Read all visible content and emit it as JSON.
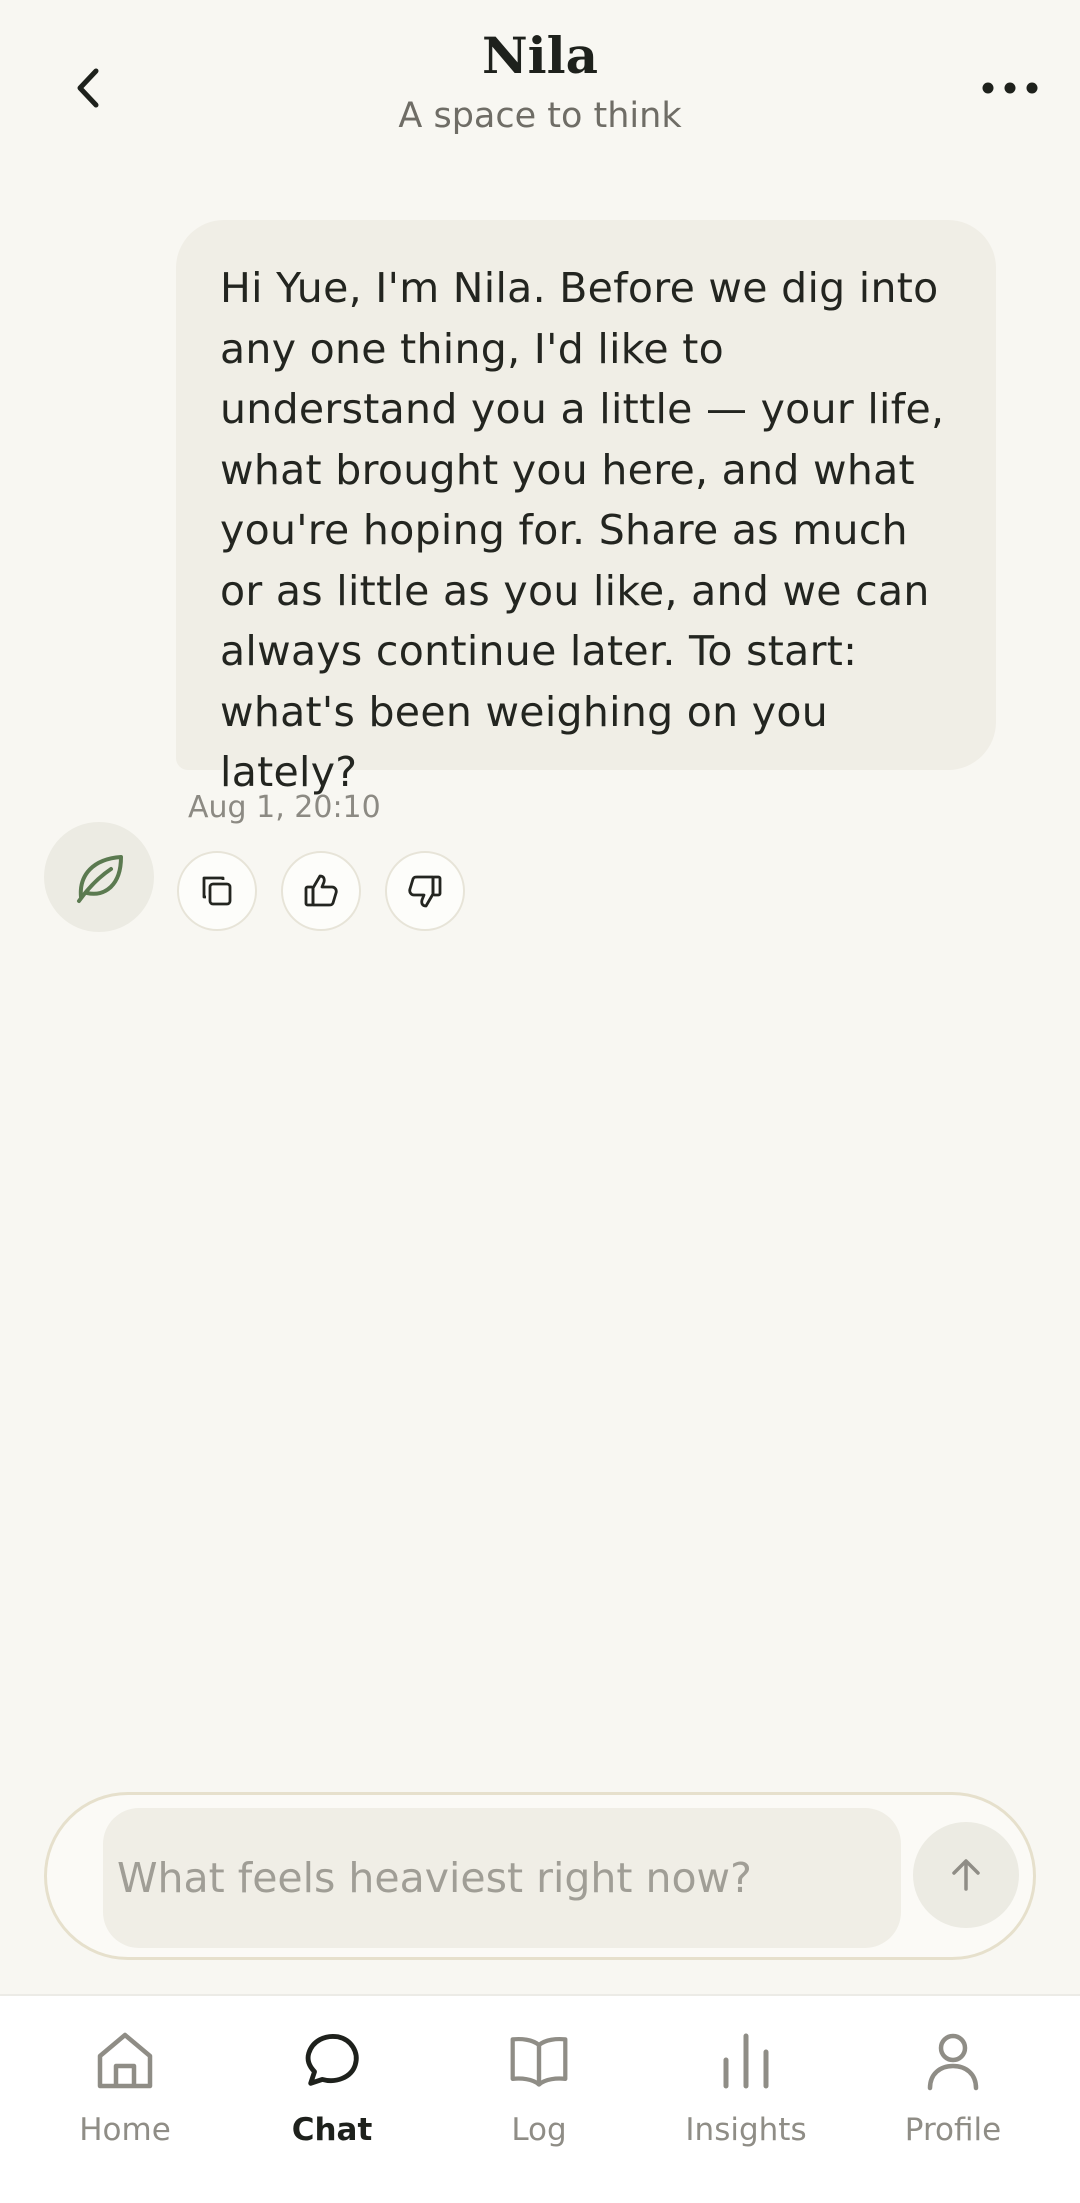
{
  "header": {
    "title": "Nila",
    "subtitle": "A space to think",
    "back_icon": "chevron-left-icon",
    "more_icon": "more-horizontal-icon"
  },
  "message": {
    "text": "Hi Yue, I'm Nila. Before we dig into any one thing, I'd like to understand you a little — your life, what brought you here, and what you're hoping for. Share as much or as little as you like, and we can always continue later. To start: what's been weighing on you lately?",
    "timestamp": "Aug 1, 20:10",
    "avatar_icon": "leaf-icon",
    "actions": [
      "copy-icon",
      "thumbs-up-icon",
      "thumbs-down-icon"
    ]
  },
  "composer": {
    "placeholder": "What feels heaviest right now?",
    "value": "",
    "send_icon": "arrow-up-icon"
  },
  "nav": {
    "items": [
      {
        "label": "Home",
        "icon": "home-icon",
        "active": false
      },
      {
        "label": "Chat",
        "icon": "chat-bubble-icon",
        "active": true
      },
      {
        "label": "Log",
        "icon": "book-icon",
        "active": false
      },
      {
        "label": "Insights",
        "icon": "bar-chart-icon",
        "active": false
      },
      {
        "label": "Profile",
        "icon": "user-icon",
        "active": false
      }
    ]
  },
  "colors": {
    "background": "#f8f7f2",
    "bubble": "#f0eee6",
    "accent_green": "#5b7a50",
    "text_dark": "#1e211c",
    "text_muted": "#8f8d86"
  }
}
